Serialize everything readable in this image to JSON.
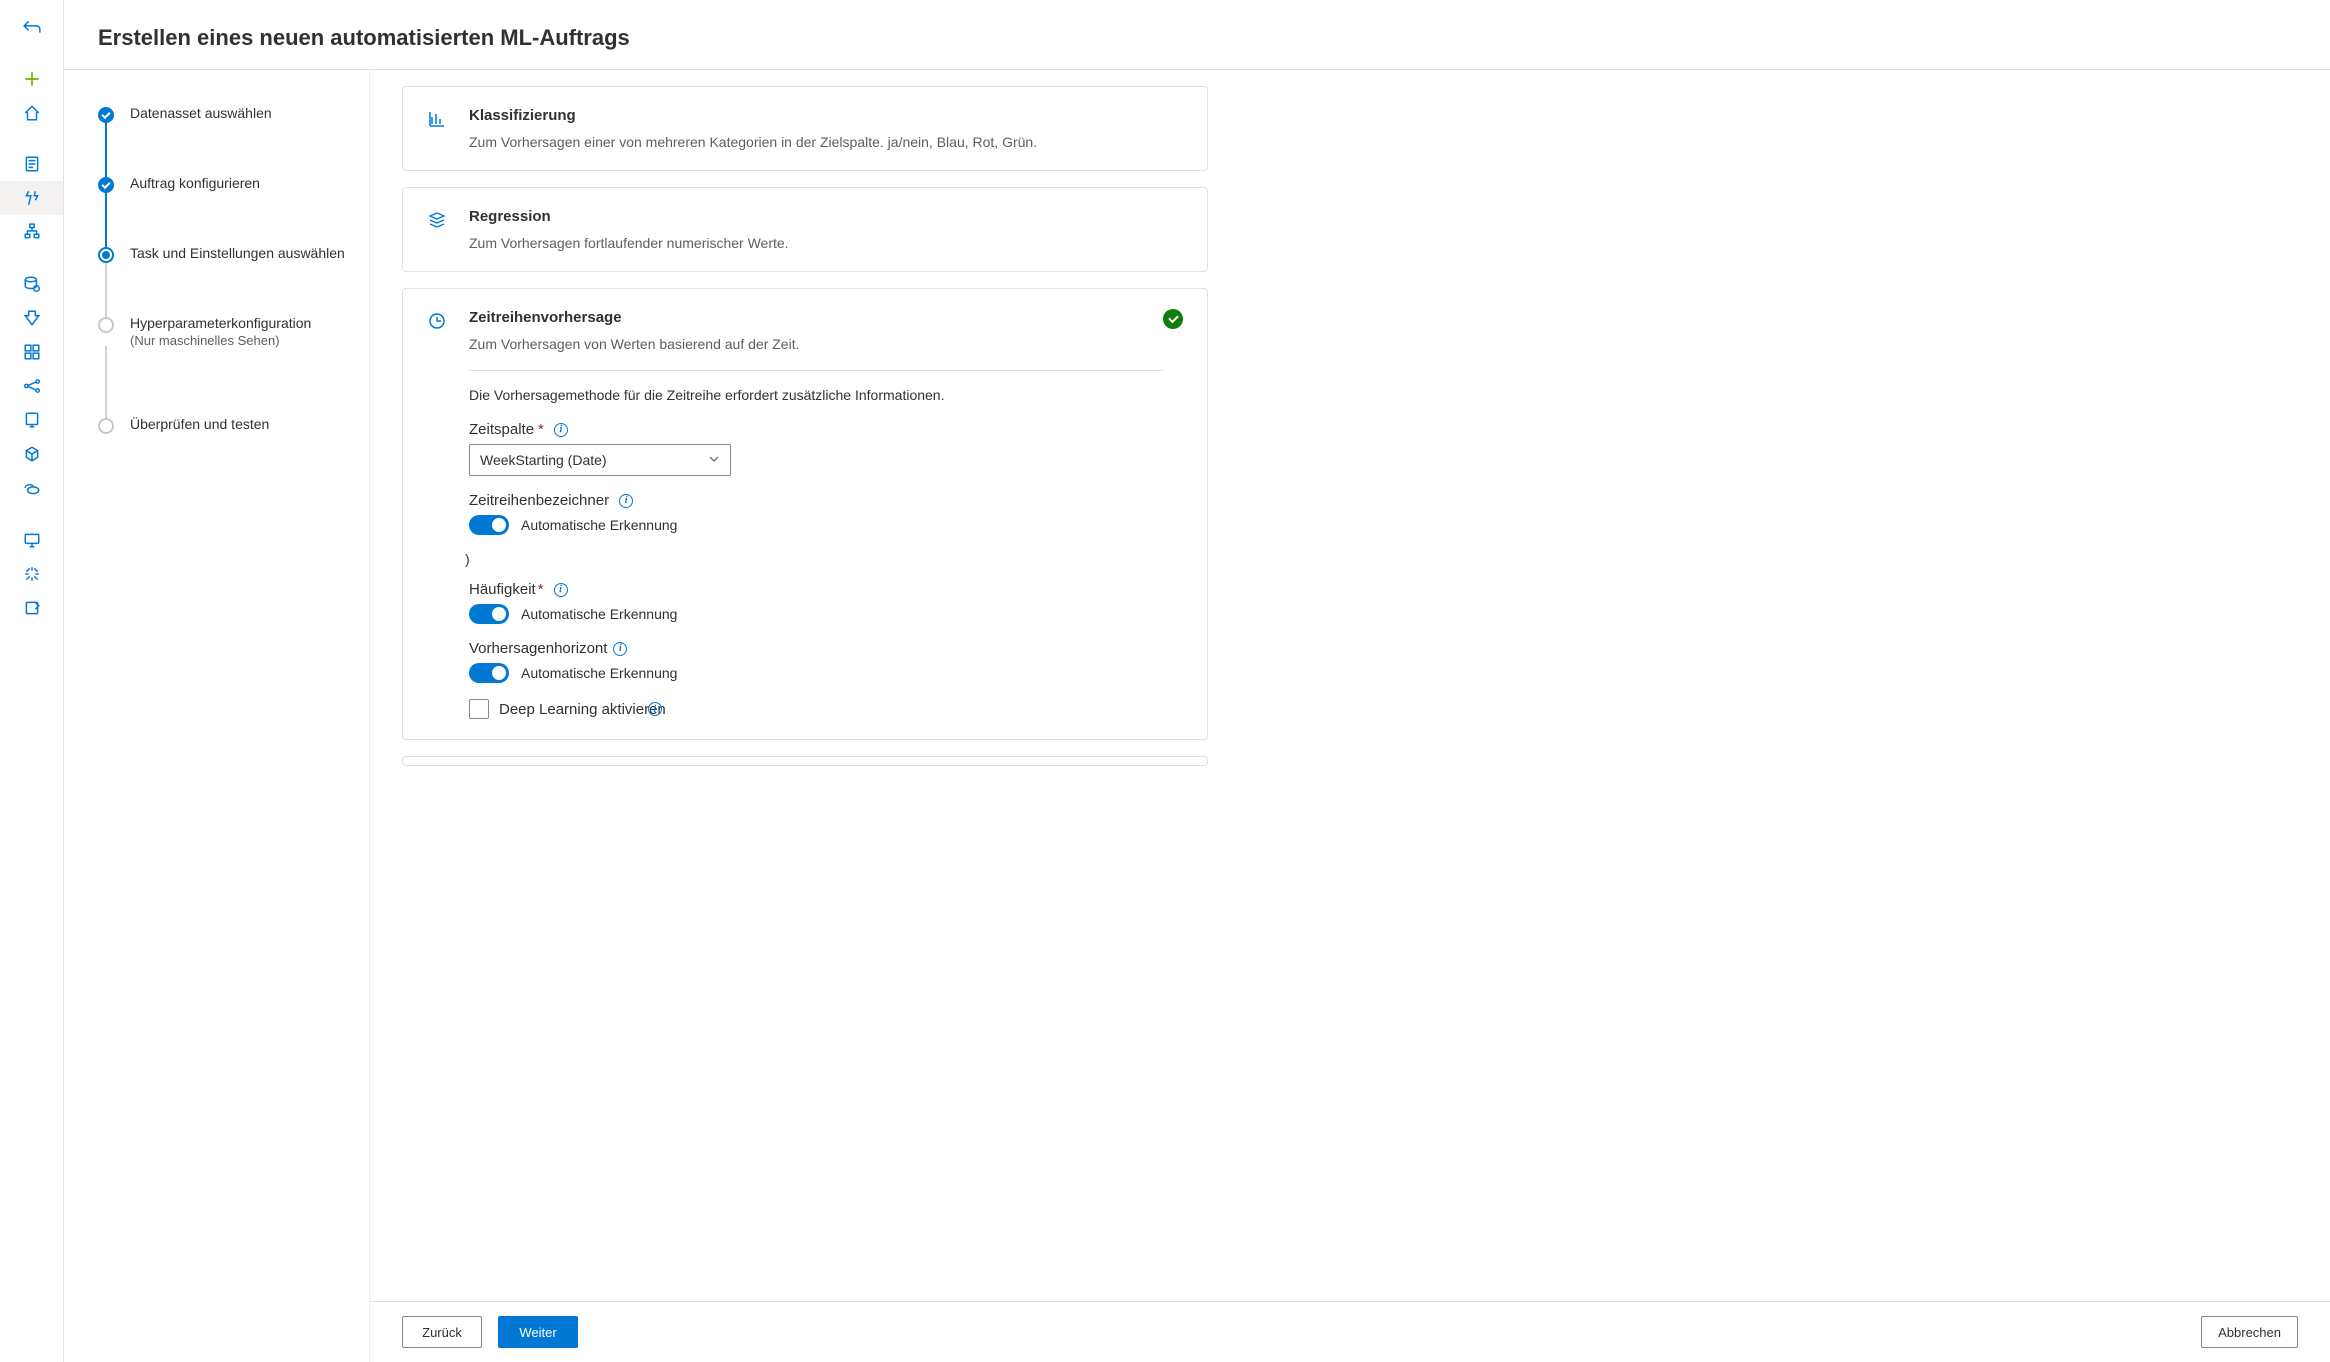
{
  "header": {
    "title": "Erstellen eines neuen automatisierten ML-Auftrags"
  },
  "steps": [
    {
      "label": "Datenasset auswählen",
      "state": "completed"
    },
    {
      "label": "Auftrag konfigurieren",
      "state": "completed"
    },
    {
      "label": "Task und Einstellungen auswählen",
      "state": "current"
    },
    {
      "label": "Hyperparameterkonfiguration",
      "sublabel": "(Nur maschinelles Sehen)",
      "state": "pending"
    },
    {
      "label": "Überprüfen und testen",
      "state": "pending"
    }
  ],
  "tasks": {
    "classification": {
      "title": "Klassifizierung",
      "desc": "Zum Vorhersagen einer von mehreren Kategorien in der Zielspalte. ja/nein, Blau, Rot, Grün."
    },
    "regression": {
      "title": "Regression",
      "desc": "Zum Vorhersagen fortlaufender numerischer Werte."
    },
    "timeseries": {
      "title": "Zeitreihenvorhersage",
      "desc": "Zum Vorhersagen von Werten basierend auf der Zeit.",
      "extra_info": "Die Vorhersagemethode für die Zeitreihe erfordert zusätzliche Informationen.",
      "time_column_label": "Zeitspalte",
      "time_column_value": "WeekStarting (Date)",
      "ts_id_label": "Zeitreihenbezeichner",
      "ts_id_toggle": "Automatische Erkennung",
      "stray": ")",
      "freq_label": "Häufigkeit",
      "freq_toggle": "Automatische Erkennung",
      "horizon_label": "Vorhersagenhorizont",
      "horizon_toggle": "Automatische Erkennung",
      "deep_learning_label": "Deep Learning aktivieren"
    }
  },
  "footer": {
    "back": "Zurück",
    "next": "Weiter",
    "cancel": "Abbrechen"
  },
  "rail": {
    "back": "back",
    "new": "new",
    "home": "home",
    "notebooks": "notebooks",
    "automl": "automl",
    "pipelines": "pipelines",
    "data": "data",
    "jobs": "jobs",
    "components": "components",
    "endpoints": "endpoints",
    "models": "models",
    "environments": "environments",
    "compute": "compute",
    "monitor": "monitor",
    "linked": "linked",
    "labeling": "labeling"
  }
}
